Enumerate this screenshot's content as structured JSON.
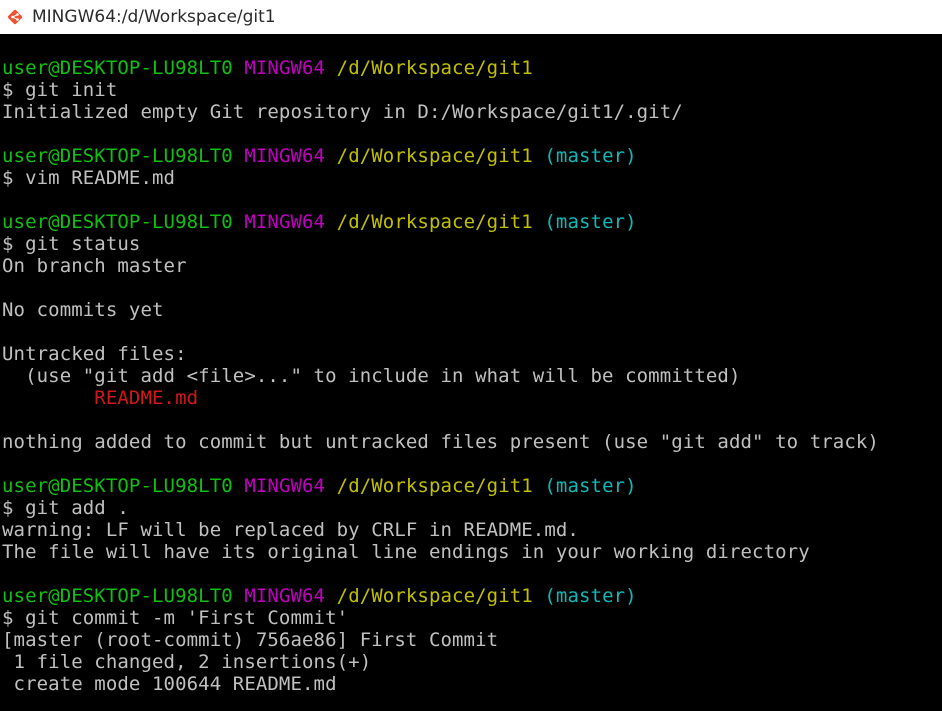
{
  "window": {
    "title": "MINGW64:/d/Workspace/git1",
    "icon": "git-bash-icon"
  },
  "colors": {
    "user": "#10c010",
    "system": "#c000c0",
    "path": "#c0c000",
    "branch": "#10b8b8",
    "untracked": "#d01818",
    "text": "#c0c0c0",
    "background": "#000000"
  },
  "terminal": {
    "prompt_user": "user@DESKTOP-LU98LT0",
    "prompt_system": "MINGW64",
    "prompt_path": "/d/Workspace/git1",
    "prompt_branch": "(master)",
    "lines": [
      {
        "kind": "prompt",
        "branch": false
      },
      {
        "kind": "text",
        "text": "$ git init"
      },
      {
        "kind": "text",
        "text": "Initialized empty Git repository in D:/Workspace/git1/.git/"
      },
      {
        "kind": "blank"
      },
      {
        "kind": "prompt",
        "branch": true
      },
      {
        "kind": "text",
        "text": "$ vim README.md"
      },
      {
        "kind": "blank"
      },
      {
        "kind": "prompt",
        "branch": true
      },
      {
        "kind": "text",
        "text": "$ git status"
      },
      {
        "kind": "text",
        "text": "On branch master"
      },
      {
        "kind": "blank"
      },
      {
        "kind": "text",
        "text": "No commits yet"
      },
      {
        "kind": "blank"
      },
      {
        "kind": "text",
        "text": "Untracked files:"
      },
      {
        "kind": "text",
        "text": "  (use \"git add <file>...\" to include in what will be committed)"
      },
      {
        "kind": "untracked",
        "text": "        README.md"
      },
      {
        "kind": "blank"
      },
      {
        "kind": "text",
        "text": "nothing added to commit but untracked files present (use \"git add\" to track)"
      },
      {
        "kind": "blank"
      },
      {
        "kind": "prompt",
        "branch": true
      },
      {
        "kind": "text",
        "text": "$ git add ."
      },
      {
        "kind": "text",
        "text": "warning: LF will be replaced by CRLF in README.md."
      },
      {
        "kind": "text",
        "text": "The file will have its original line endings in your working directory"
      },
      {
        "kind": "blank"
      },
      {
        "kind": "prompt",
        "branch": true
      },
      {
        "kind": "text",
        "text": "$ git commit -m 'First Commit'"
      },
      {
        "kind": "text",
        "text": "[master (root-commit) 756ae86] First Commit"
      },
      {
        "kind": "text",
        "text": " 1 file changed, 2 insertions(+)"
      },
      {
        "kind": "text",
        "text": " create mode 100644 README.md"
      }
    ]
  }
}
